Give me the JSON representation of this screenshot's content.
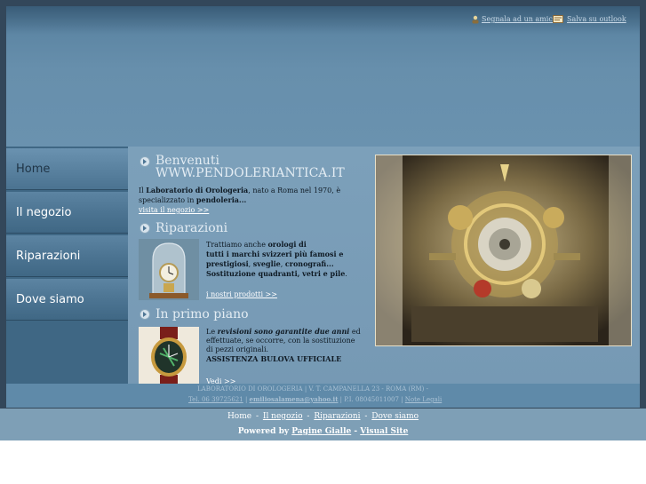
{
  "top_links": {
    "recommend": "Segnala ad un amico",
    "outlook": "Salva su outlook"
  },
  "sidebar": {
    "items": [
      {
        "label": "Home",
        "active": true
      },
      {
        "label": "Il negozio",
        "active": false
      },
      {
        "label": "Riparazioni",
        "active": false
      },
      {
        "label": "Dove siamo",
        "active": false
      }
    ]
  },
  "welcome": {
    "title_line1": "Benvenuti",
    "title_line2": "WWW.PENDOLERIANTICA.IT",
    "text_p1": "Il ",
    "text_b1": "Laboratorio di Orologeria",
    "text_p2": ", nato a Roma nel 1970, è",
    "text_p3": "specializzato in ",
    "text_b2": "pendoleria...",
    "link": "visita il negozio >>"
  },
  "repairs": {
    "title": "Riparazioni",
    "l1a": "Trattiamo anche ",
    "l1b": "orologi di",
    "l2a": "tutti i ",
    "l2b": "marchi svizzeri",
    "l2c": " più famosi e",
    "l3a": "prestigiosi",
    "l3b": ", ",
    "l3c": "sveglie",
    "l3d": ", ",
    "l3e": "cronografi...",
    "l4a": "Sostituzione quadranti, vetri e pile",
    "l4b": ".",
    "link": "i nostri prodotti >>"
  },
  "featured": {
    "title": "In primo piano",
    "l1a": "Le ",
    "l1b": "revisioni sono garantite",
    "l1c": " due anni",
    "l1d": " ed",
    "l2": "effettuate, se occorre, con la sostituzione",
    "l3": "di pezzi originali.",
    "l4a": "ASSISTENZA ",
    "l4b": "BULOVA",
    "l4c": " UFFICIALE",
    "link": "Vedi >>"
  },
  "footer": {
    "line1": "LABORATORIO DI OROLOGERIA | V. T. CAMPANELLA 23 - ROMA (RM) -",
    "tel": "Tel. 06 39725621",
    "sep1": " | ",
    "email": "emiliosalamena@yahoo.it",
    "piva": " | P.I. 08045011007 | ",
    "legal": "Note Legali"
  },
  "bottom_nav": {
    "home": "Home",
    "negozio": "Il negozio",
    "riparazioni": "Riparazioni",
    "dove": "Dove siamo",
    "sep": "-"
  },
  "powered": {
    "label": "Powered by",
    "pg": "Pagine Gialle",
    "dash": "-",
    "vs": "Visual Site"
  },
  "colors": {
    "accent_red": "#d20000",
    "banner": "#6a92af",
    "sidebar": "#3f6784"
  }
}
